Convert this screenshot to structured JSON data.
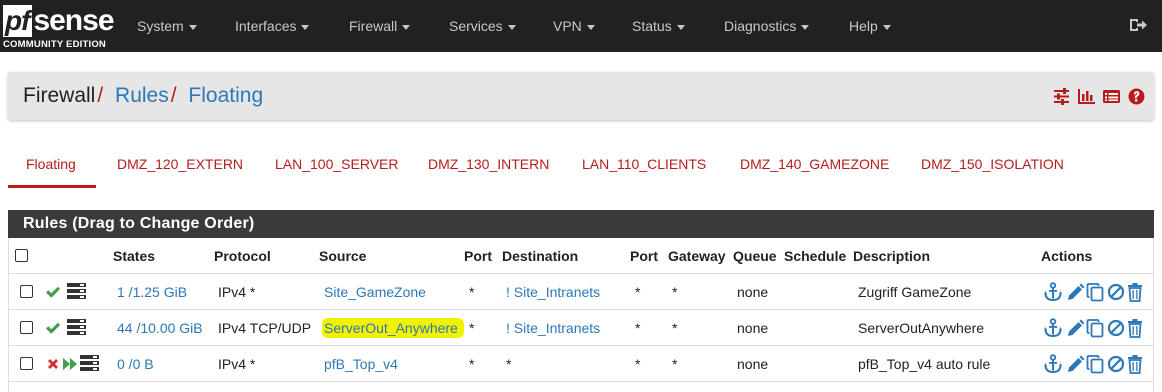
{
  "brand": {
    "logo_pf": "pf",
    "logo_sense": "sense",
    "edition": "COMMUNITY EDITION"
  },
  "nav": {
    "items": [
      "System",
      "Interfaces",
      "Firewall",
      "Services",
      "VPN",
      "Status",
      "Diagnostics",
      "Help"
    ],
    "logout_icon": "sign-out-icon"
  },
  "breadcrumb": {
    "root": "Firewall",
    "level1": "Rules",
    "level2": "Floating",
    "separator": "/"
  },
  "header_icons": [
    "sliders-icon",
    "bar-chart-icon",
    "list-icon",
    "help-icon"
  ],
  "tabs": [
    "Floating",
    "DMZ_120_EXTERN",
    "LAN_100_SERVER",
    "DMZ_130_INTERN",
    "LAN_110_CLIENTS",
    "DMZ_140_GAMEZONE",
    "DMZ_150_ISOLATION"
  ],
  "active_tab": "Floating",
  "panel": {
    "title": "Rules (Drag to Change Order)"
  },
  "table": {
    "columns": {
      "states": "States",
      "protocol": "Protocol",
      "source": "Source",
      "src_port": "Port",
      "destination": "Destination",
      "dst_port": "Port",
      "gateway": "Gateway",
      "queue": "Queue",
      "schedule": "Schedule",
      "description": "Description",
      "actions": "Actions"
    },
    "rows": [
      {
        "status": "pass",
        "states": "1 /1.25 GiB",
        "protocol": "IPv4 *",
        "source": "Site_GameZone",
        "source_link": true,
        "highlight": false,
        "src_port": "*",
        "destination": "! Site_Intranets",
        "dest_link": true,
        "dst_port": "*",
        "gateway": "*",
        "queue": "none",
        "schedule": "",
        "description": "Zugriff GameZone"
      },
      {
        "status": "pass",
        "states": "44 /10.00 GiB",
        "protocol": "IPv4 TCP/UDP",
        "source": "ServerOut_Anywhere",
        "source_link": true,
        "highlight": true,
        "src_port": "*",
        "destination": "! Site_Intranets",
        "dest_link": true,
        "dst_port": "*",
        "gateway": "*",
        "queue": "none",
        "schedule": "",
        "description": "ServerOutAnywhere"
      },
      {
        "status": "block-quick",
        "states": "0 /0 B",
        "protocol": "IPv4 *",
        "source": "pfB_Top_v4",
        "source_link": true,
        "highlight": false,
        "src_port": "*",
        "destination": "*",
        "dest_link": false,
        "dst_port": "*",
        "gateway": "*",
        "queue": "none",
        "schedule": "",
        "description": "pfB_Top_v4 auto rule"
      }
    ],
    "action_icons": [
      "anchor-icon",
      "pencil-icon",
      "copy-icon",
      "disable-icon",
      "trash-icon"
    ]
  },
  "colors": {
    "navbar": "#212121",
    "accent_red": "#b71c1c",
    "link_blue": "#2c78b8",
    "pass_green": "#43a047",
    "block_red": "#d32f2f",
    "highlight": "#f2f200"
  }
}
